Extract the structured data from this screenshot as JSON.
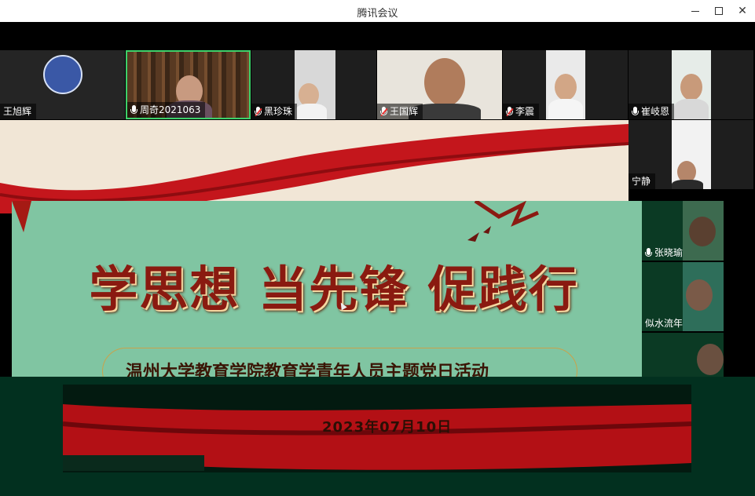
{
  "window": {
    "title": "腾讯会议"
  },
  "participants": [
    {
      "name": "王旭辉",
      "mic": "none"
    },
    {
      "name": "周奇2021063",
      "mic": "on",
      "speaking": true
    },
    {
      "name": "黑珍珠",
      "mic": "muted"
    },
    {
      "name": "王国辉",
      "mic": "muted"
    },
    {
      "name": "李震",
      "mic": "muted"
    },
    {
      "name": "崔岐恩",
      "mic": "on"
    },
    {
      "name": "宁静",
      "mic": "none"
    },
    {
      "name": "张晓瑜",
      "mic": "on"
    },
    {
      "name": "似水流年",
      "mic": "none"
    },
    {
      "name": "",
      "mic": "none"
    }
  ],
  "slide": {
    "slogan": "学思想 当先锋 促践行",
    "subtitle": "温州大学教育学院教育学青年人员主题党日活动",
    "date": "2023年07月10日"
  },
  "colors": {
    "speaking_border": "#3dd06a",
    "slide_green": "#7fc3a0",
    "ribbon_red": "#c4161c"
  }
}
